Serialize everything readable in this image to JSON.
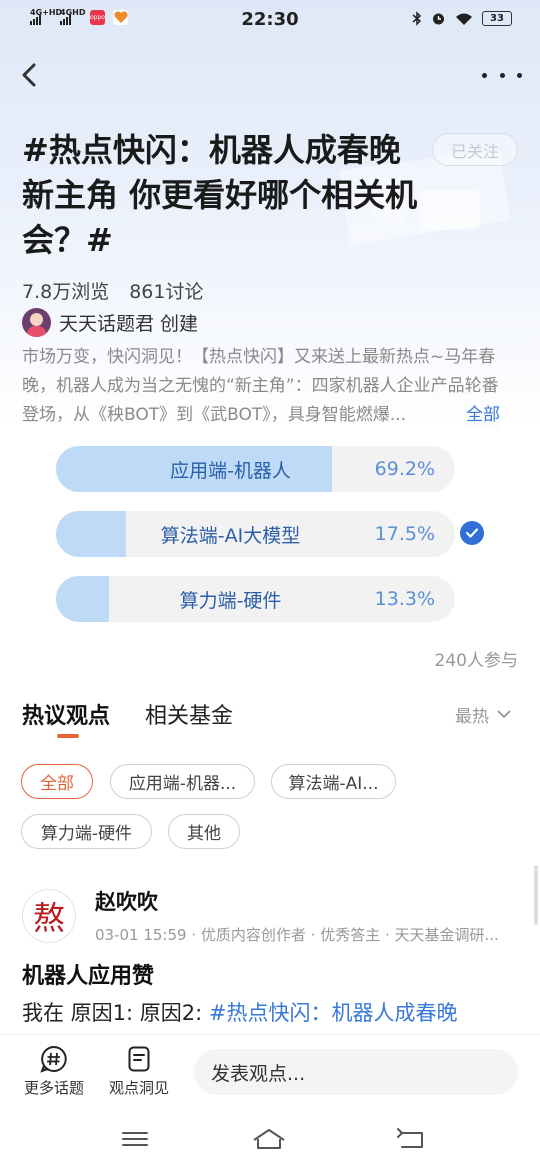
{
  "status_bar": {
    "time": "22:30",
    "signal1_label": "4G+HD",
    "signal2_label": "4GHD",
    "battery": "33"
  },
  "topic": {
    "title": "#热点快闪：机器人成春晚新主角 你更看好哪个相关机会？#",
    "follow_label": "已关注",
    "views": "7.8万浏览",
    "discussions": "861讨论",
    "creator": "天天话题君 创建",
    "description": "市场万变，快闪洞见！【热点快闪】又来送上最新热点~马年春晚，机器人成为当之无愧的“新主角”：四家机器人企业产品轮番登场，从《秧BOT》到《武BOT》，具身智能燃爆...",
    "more_label": "全部"
  },
  "poll": {
    "options": [
      {
        "label": "应用端-机器人",
        "percent": "69.2%",
        "fill": 0.692,
        "selected": false
      },
      {
        "label": "算法端-AI大模型",
        "percent": "17.5%",
        "fill": 0.175,
        "selected": true
      },
      {
        "label": "算力端-硬件",
        "percent": "13.3%",
        "fill": 0.133,
        "selected": false
      }
    ],
    "participants": "240人参与"
  },
  "tabs": {
    "active": "热议观点",
    "second": "相关基金",
    "sort": "最热"
  },
  "filters": [
    "全部",
    "应用端-机器...",
    "算法端-AI...",
    "算力端-硬件",
    "其他"
  ],
  "post": {
    "avatar_char": "熬",
    "name": "赵吹吹",
    "meta": "03-01 15:59 · 优质内容创作者 · 优秀答主 · 天天基金调研...",
    "title": "机器人应用赞",
    "body_prefix": "我在 原因1: 原因2: ",
    "body_tag": "#热点快闪：机器人成春晚"
  },
  "bottom_bar": {
    "more_topics": "更多话题",
    "insights": "观点洞见",
    "input_placeholder": "发表观点..."
  },
  "colors": {
    "accent_orange": "#e5643a",
    "poll_fill": "#bedaf7",
    "link_blue": "#3a78d8",
    "check_blue": "#2f6fd6"
  }
}
